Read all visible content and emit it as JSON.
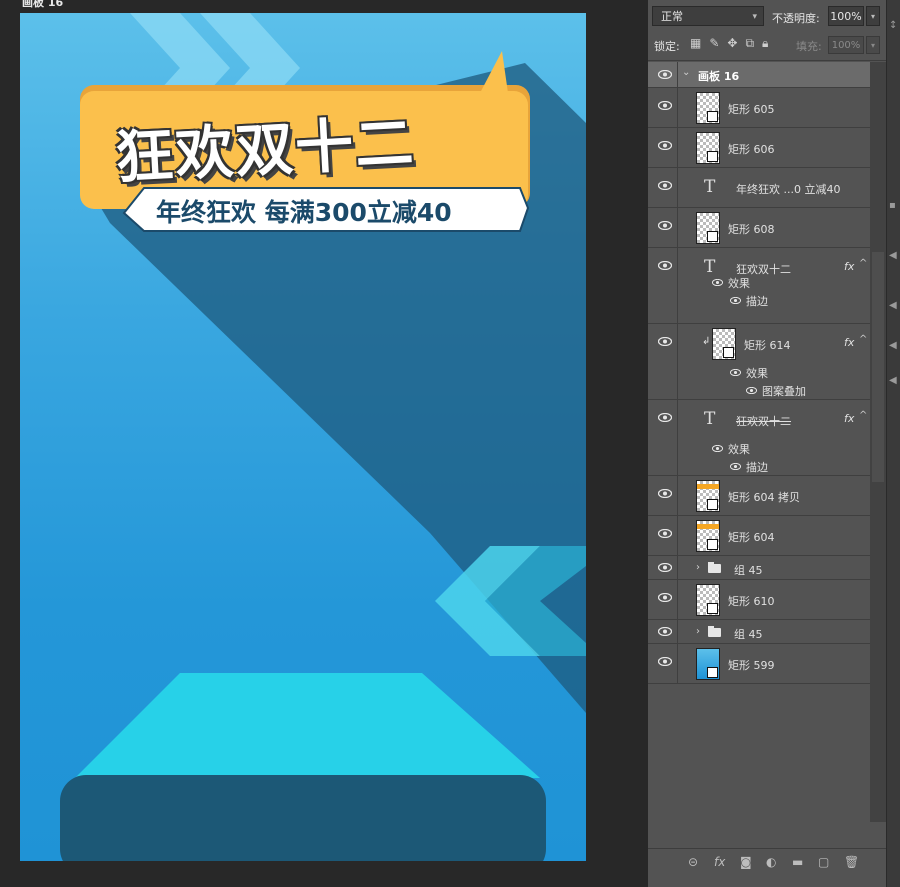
{
  "artboard": {
    "label": "画板 16"
  },
  "poster": {
    "title": "狂欢双十二",
    "subtitle": "年终狂欢 每满300立减40",
    "colors": {
      "background_top": "#5cc0ea",
      "background_bottom": "#1f93d6",
      "banner": "#fbc04c",
      "stage_top": "#27d1e8",
      "stage_base": "#1c5876",
      "shadow": "#1e5a7d"
    }
  },
  "panel": {
    "blend_mode": "正常",
    "opacity_label": "不透明度:",
    "opacity_value": "100%",
    "lock_label": "锁定:",
    "fill_label": "填充:",
    "fill_value": "100%"
  },
  "layers": [
    {
      "id": "artboard",
      "name": "画板 16"
    },
    {
      "id": "rect605",
      "name": "矩形 605"
    },
    {
      "id": "rect606",
      "name": "矩形 606"
    },
    {
      "id": "text-sub",
      "name": "年终狂欢 ...0 立减40"
    },
    {
      "id": "rect608",
      "name": "矩形 608"
    },
    {
      "id": "text-title",
      "name": "狂欢双十二",
      "effects_label": "效果",
      "effect": "描边"
    },
    {
      "id": "rect614",
      "name": "矩形 614",
      "effects_label": "效果",
      "effect": "图案叠加"
    },
    {
      "id": "text-title2",
      "name": "狂欢双十二",
      "effects_label": "效果",
      "effect": "描边"
    },
    {
      "id": "rect604copy",
      "name": "矩形 604 拷贝"
    },
    {
      "id": "rect604",
      "name": "矩形 604"
    },
    {
      "id": "group45a",
      "name": "组 45"
    },
    {
      "id": "rect610",
      "name": "矩形 610"
    },
    {
      "id": "group45b",
      "name": "组 45"
    },
    {
      "id": "rect599",
      "name": "矩形 599"
    }
  ],
  "icons": {
    "fx": "fx",
    "bottom": [
      "link-icon",
      "fx-icon",
      "mask-icon",
      "adjustment-icon",
      "folder-icon",
      "new-layer-icon",
      "trash-icon"
    ]
  }
}
